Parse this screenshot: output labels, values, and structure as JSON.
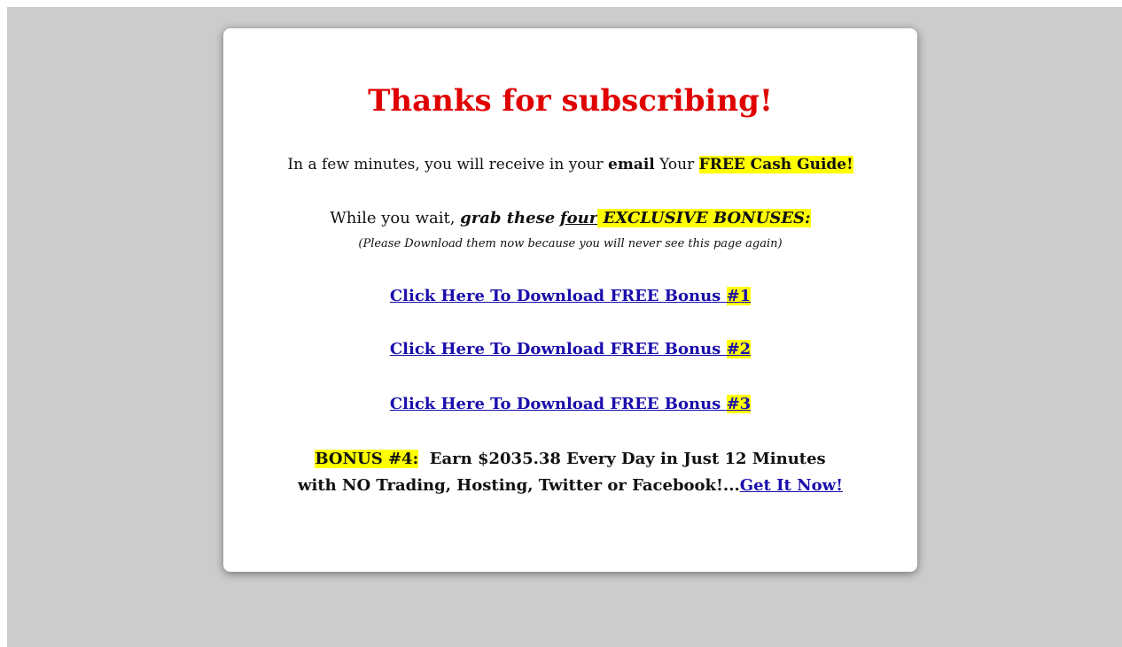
{
  "colors": {
    "page_background": "#cccccc",
    "card_background": "#ffffff",
    "headline": "#e00000",
    "link": "#1a0dab",
    "highlight": "#ffff00"
  },
  "headline": "Thanks for subscribing!",
  "intro": {
    "prefix": "In a few minutes, you will receive in your ",
    "email_word": "email",
    "middle": " Your ",
    "guide": "FREE Cash Guide!"
  },
  "bonus_intro": {
    "prefix": "While you wait, ",
    "grab": "grab these",
    "space": " ",
    "four": "four",
    "exclusive": " EXCLUSIVE BONUSES:",
    "note": "(Please Download them now because you will never see this page again)"
  },
  "downloads": [
    {
      "label": "Click Here To Download FREE Bonus ",
      "number": "#1"
    },
    {
      "label": "Click Here To Download FREE Bonus ",
      "number": "#2"
    },
    {
      "label": "Click Here To Download FREE Bonus ",
      "number": "#3"
    }
  ],
  "bonus4": {
    "tag": "BONUS #4:",
    "line1": "  Earn $2035.38 Every Day in Just 12 Minutes",
    "line2": "with NO Trading, Hosting, Twitter or Facebook!...",
    "cta": "Get It Now!"
  }
}
